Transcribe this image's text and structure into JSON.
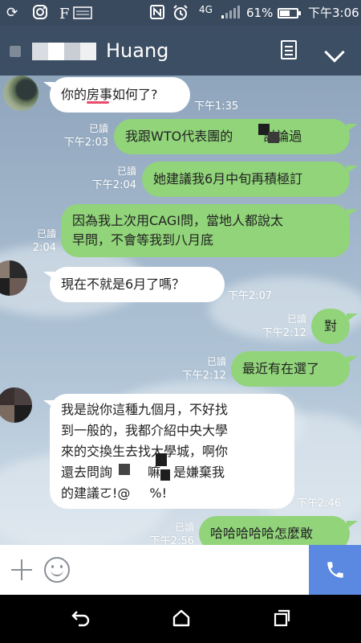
{
  "status_bar": {
    "battery_percent": "61%",
    "signal_label": "4G",
    "time": "下午3:06",
    "battery_level": 0.61
  },
  "header": {
    "title": "Huang"
  },
  "messages": [
    {
      "side": "in",
      "text": "你的房事如何了?",
      "time": "下午1:35"
    },
    {
      "side": "out",
      "text": "我跟WTO代表團的",
      "text_end": "討論過",
      "read": "已讀",
      "time": "下午2:03"
    },
    {
      "side": "out",
      "text": "她建議我6月中旬再積極訂",
      "read": "已讀",
      "time": "下午2:04"
    },
    {
      "side": "out",
      "lines": [
        "因為我上次用CAGI問，當地人都說太",
        "早問，不會等我到八月底"
      ],
      "read": "已讀",
      "time": "2:04"
    },
    {
      "side": "in",
      "text": "現在不就是6月了嗎？",
      "time": "下午2:07"
    },
    {
      "side": "out",
      "text": "對",
      "read": "已讀",
      "time": "下午2:12"
    },
    {
      "side": "out",
      "text": "最近有在選了",
      "read": "已讀",
      "time": "下午2:12"
    },
    {
      "side": "in",
      "lines": [
        "我是說你這種九個月，不好找",
        "到一般的，我都介紹中央大學",
        "來的交換生去找大學城，啊你",
        "還去問詢",
        "嘛，是嫌棄我",
        "的建議ㄛ!@",
        "%!"
      ],
      "time": "下午2:46"
    },
    {
      "side": "out",
      "text": "哈哈哈哈哈怎麼敢",
      "read": "已讀",
      "time": "下午2:56"
    }
  ],
  "colors": {
    "header_bg": "#3c4e63",
    "bubble_out": "#91d47a",
    "bubble_in": "#ffffff",
    "call_button": "#5b88e0"
  },
  "icons": [
    "sync-icon",
    "instagram-icon",
    "newspaper-icon",
    "nfc-icon",
    "alarm-icon",
    "signal-icon",
    "battery-icon",
    "notes-icon",
    "chevron-down-icon",
    "plus-icon",
    "emoji-icon",
    "phone-icon",
    "back-icon",
    "home-icon",
    "recent-apps-icon"
  ]
}
